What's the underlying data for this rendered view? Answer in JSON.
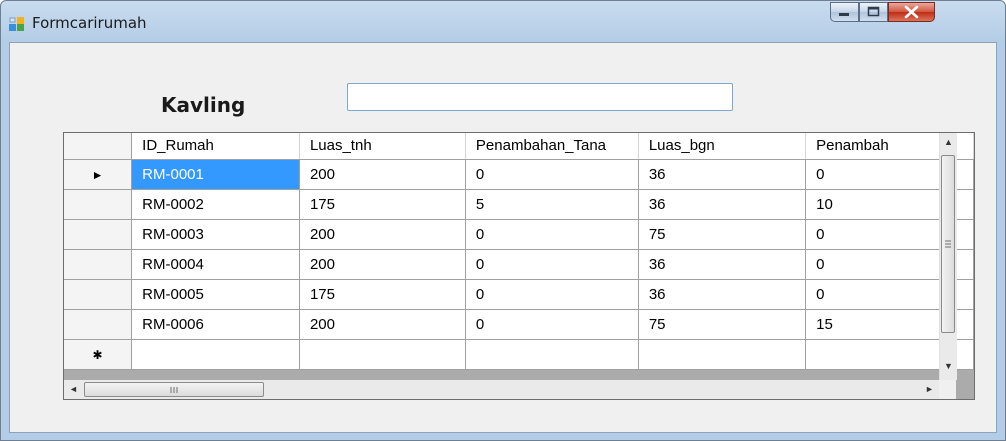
{
  "window": {
    "title": "Formcarirumah"
  },
  "form": {
    "kavling_label": "Kavling",
    "kavling_value": ""
  },
  "grid": {
    "columns": [
      "ID_Rumah",
      "Luas_tnh",
      "Penambahan_Tana",
      "Luas_bgn",
      "Penambah"
    ],
    "rows": [
      [
        "RM-0001",
        "200",
        "0",
        "36",
        "0"
      ],
      [
        "RM-0002",
        "175",
        "5",
        "36",
        "10"
      ],
      [
        "RM-0003",
        "200",
        "0",
        "75",
        "0"
      ],
      [
        "RM-0004",
        "200",
        "0",
        "36",
        "0"
      ],
      [
        "RM-0005",
        "175",
        "0",
        "36",
        "0"
      ],
      [
        "RM-0006",
        "200",
        "0",
        "75",
        "15"
      ]
    ],
    "current_row_marker": "►",
    "new_row_marker": "✱"
  }
}
